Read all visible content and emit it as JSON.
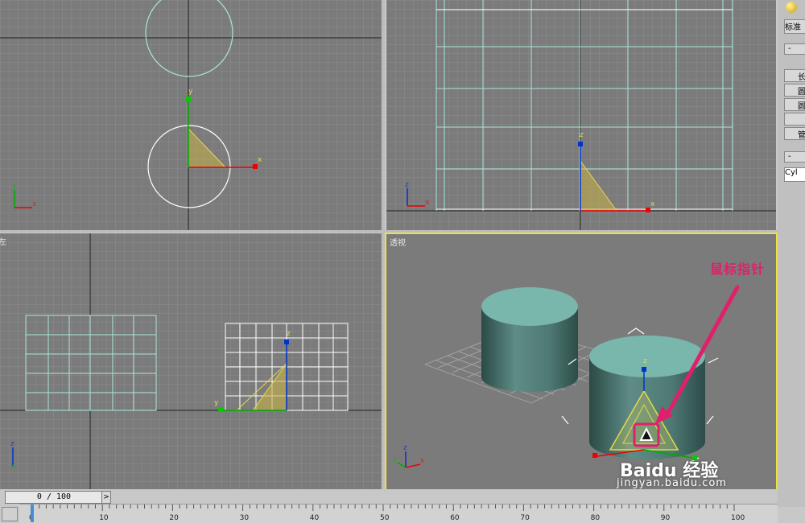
{
  "viewports": {
    "top_left": {
      "label": ""
    },
    "top_right": {
      "label": ""
    },
    "left": {
      "label": "左"
    },
    "perspective": {
      "label": "透视"
    }
  },
  "gizmo": {
    "x_label": "x",
    "y_label": "y",
    "z_label": "z"
  },
  "annotation": {
    "text": "鼠标指针"
  },
  "timeline": {
    "frame_display": "0 / 100",
    "ticks": [
      "0",
      "10",
      "20",
      "30",
      "40",
      "50",
      "60",
      "70",
      "80",
      "90",
      "100"
    ]
  },
  "command_panel": {
    "dropdown_value": "标准",
    "rollout_minus": "-",
    "buttons": [
      "长",
      "圆",
      "圆",
      "",
      "管"
    ],
    "name_field": "Cyl"
  },
  "watermark": {
    "brand": "Baidu 经验",
    "url": "jingyan.baidu.com"
  },
  "colors": {
    "viewport_bg": "#7b7b7b",
    "grid": "#8a8a8a",
    "cyan_wire": "#a8e6dc",
    "yellow": "#e8d84a",
    "active_border": "#f0e040",
    "annotation": "#e0206a"
  }
}
